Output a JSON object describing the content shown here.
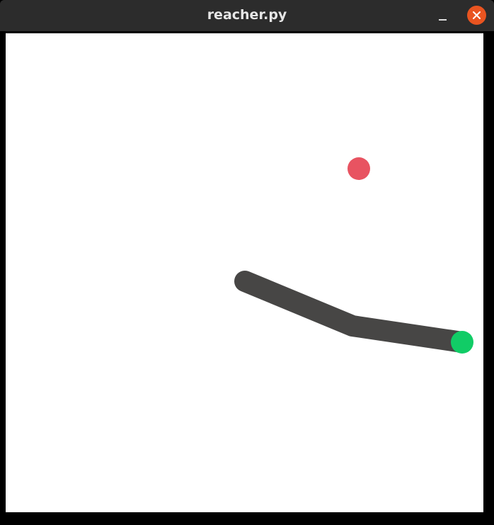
{
  "window": {
    "title": "reacher.py"
  },
  "icons": {
    "minimize": "minimize-icon",
    "close": "close-icon"
  },
  "colors": {
    "titlebar": "#2c2c2c",
    "close_button": "#e95420",
    "arm": "#474645",
    "target": "#e85361",
    "end_effector": "#11cc66",
    "canvas": "#ffffff"
  }
}
